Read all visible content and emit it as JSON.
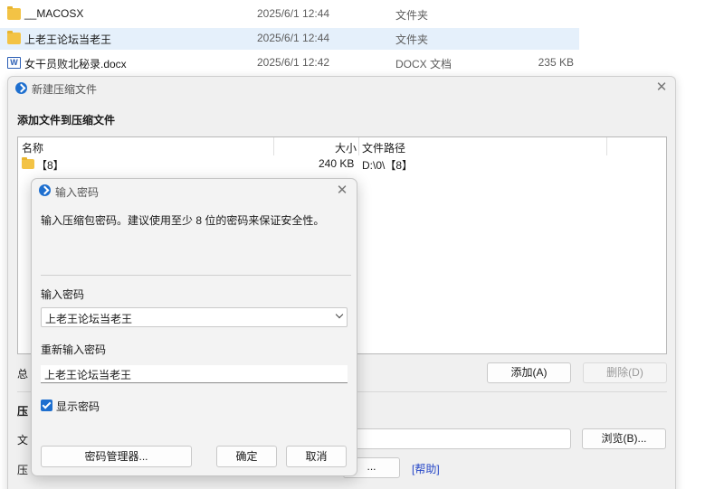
{
  "explorer": {
    "files": [
      {
        "name": "__MACOSX",
        "date": "2025/6/1 12:44",
        "type": "文件夹",
        "size": "",
        "icon": "folder-icon"
      },
      {
        "name": "上老王论坛当老王",
        "date": "2025/6/1 12:44",
        "type": "文件夹",
        "size": "",
        "icon": "folder-icon"
      },
      {
        "name": "女干员败北秘录.docx",
        "date": "2025/6/1 12:42",
        "type": "DOCX 文档",
        "size": "235 KB",
        "icon": "word-doc-icon"
      }
    ]
  },
  "main_dialog": {
    "title": "新建压缩文件",
    "section_add": "添加文件到压缩文件",
    "list_headers": {
      "name": "名称",
      "size": "大小",
      "path": "文件路径"
    },
    "list_rows": [
      {
        "name": "【8】",
        "size": "240 KB",
        "path": "D:\\0\\【8】"
      }
    ],
    "total_label_partial": "总",
    "add_button": "添加(A)",
    "delete_button": "删除(D)",
    "section_compress_partial": "压",
    "file_label_partial": "文",
    "compress_label_partial": "压",
    "browse_button": "浏览(B)...",
    "ellipsis_button": "...",
    "help_link": "[帮助]"
  },
  "password_dialog": {
    "title": "输入密码",
    "description": "输入压缩包密码。建议使用至少 8 位的密码来保证安全性。",
    "password_label": "输入密码",
    "password_value": "上老王论坛当老王",
    "reenter_label": "重新输入密码",
    "reenter_value": "上老王论坛当老王",
    "show_password_label": "显示密码",
    "show_password_checked": true,
    "manager_button": "密码管理器...",
    "ok_button": "确定",
    "cancel_button": "取消"
  },
  "colors": {
    "accent": "#1e6fcf",
    "selection": "#e5f0fb",
    "link": "#2546c7"
  }
}
